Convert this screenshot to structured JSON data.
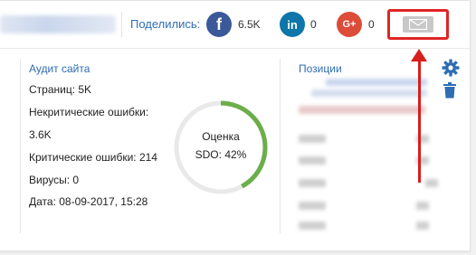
{
  "header": {
    "share_label": "Поделились:",
    "social": [
      {
        "network": "facebook",
        "icon_text": "f",
        "count": "6.5K",
        "color": "#3b5998"
      },
      {
        "network": "linkedin",
        "icon_text": "in",
        "count": "0",
        "color": "#0e76a8"
      },
      {
        "network": "google-plus",
        "icon_text": "G+",
        "count": "0",
        "color": "#dd4b39"
      }
    ],
    "mail_highlight_color": "#e02424"
  },
  "audit": {
    "title": "Аудит сайта",
    "pages": "Страниц: 5K",
    "noncritical_label": "Некритические ошибки:",
    "noncritical_value": "3.6K",
    "critical": "Критические ошибки: 214",
    "viruses": "Вирусы: 0",
    "date": "Дата: 08-09-2017, 15:28"
  },
  "score": {
    "label": "Оценка",
    "value": "SDO: 42%",
    "percent": 42,
    "color": "#6cae4a"
  },
  "positions": {
    "title": "Позиции"
  },
  "colors": {
    "accent": "#2e6db3",
    "arrow": "#d81e1e"
  }
}
